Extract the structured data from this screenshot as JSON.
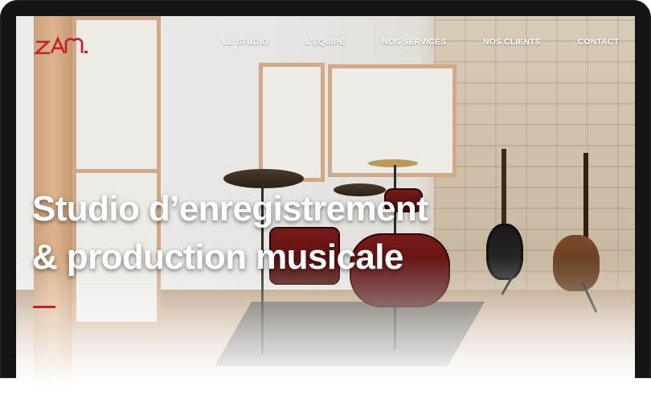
{
  "nav": {
    "items": [
      {
        "label": "LE STUDIO"
      },
      {
        "label": "L'EQUIPE"
      },
      {
        "label": "NOS SERVICES"
      },
      {
        "label": "NOS CLIENTS"
      },
      {
        "label": "CONTACT"
      }
    ]
  },
  "hero": {
    "line1": "Studio d’enregistrement",
    "line2": "& production musicale"
  },
  "colors": {
    "accent": "#c8202a",
    "nav_text": "#ffffff",
    "device_frame": "#151515"
  },
  "icons": {
    "logo": "zam-logo"
  }
}
